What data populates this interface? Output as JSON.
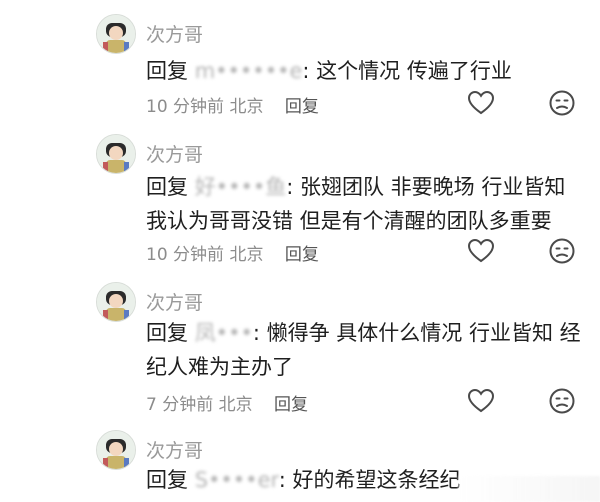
{
  "comments": [
    {
      "username": "次方哥",
      "reply_word": "回复",
      "mention": "m••••••e",
      "text": ": 这个情况 传遍了行业",
      "time": "10 分钟前 北京",
      "reply_label": "回复"
    },
    {
      "username": "次方哥",
      "reply_word": "回复",
      "mention": "好••••鱼",
      "text": ": 张翅团队 非要晚场 行业皆知 我认为哥哥没错 但是有个清醒的团队多重要",
      "time": "10 分钟前 北京",
      "reply_label": "回复"
    },
    {
      "username": "次方哥",
      "reply_word": "回复",
      "mention": "凤•••",
      "text": ": 懒得争 具体什么情况 行业皆知 经纪人难为主办了",
      "time": "7 分钟前 北京",
      "reply_label": "回复"
    },
    {
      "username": "次方哥",
      "reply_word": "回复",
      "mention": "S••••er",
      "text": ": 好的希望这条经纪",
      "time": "",
      "reply_label": ""
    }
  ],
  "icons": {
    "like": "heart-outline-icon",
    "dislike": "unhappy-face-icon"
  },
  "colors": {
    "username": "#9a9a9a",
    "meta": "#8c8c8c",
    "text": "#1f1f1f"
  }
}
